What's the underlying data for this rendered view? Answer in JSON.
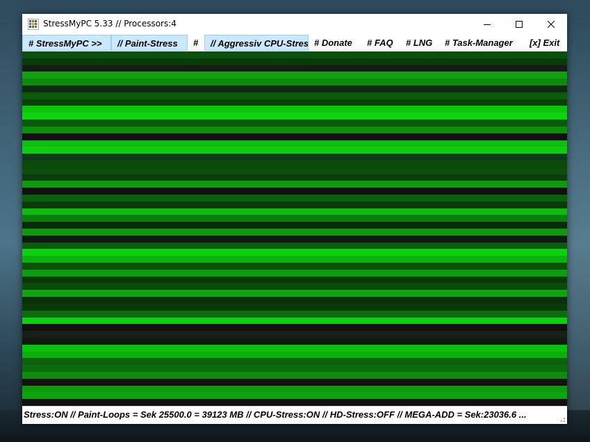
{
  "window": {
    "title": "StressMyPC 5.33 // Processors:4",
    "icon": "app-grid-icon"
  },
  "controls": {
    "minimize": "minimize-icon",
    "maximize": "maximize-icon",
    "close": "close-icon"
  },
  "menu": {
    "items": [
      {
        "label": "# StressMyPC >>",
        "active": true
      },
      {
        "label": "// Paint-Stress",
        "active": true
      },
      {
        "label": "#",
        "active": false
      },
      {
        "label": "// Aggressiv CPU-Stress",
        "active": true
      },
      {
        "label": "# Donate",
        "active": false
      },
      {
        "label": "# FAQ",
        "active": false
      },
      {
        "label": "# LNG",
        "active": false
      },
      {
        "label": "# Task-Manager",
        "active": false
      },
      {
        "label": "[x] Exit",
        "active": false
      }
    ]
  },
  "paint_area": {
    "stripe_colors": [
      "#0d4f0d",
      "#0a3a0a",
      "#151c14",
      "#10a010",
      "#0c8a0c",
      "#0f2a0f",
      "#0b5a0b",
      "#0a3f0a",
      "#0ec20e",
      "#0ed60e",
      "#0a5a0a",
      "#0b8c0b",
      "#130f10",
      "#0fbf0f",
      "#0fcc0f",
      "#0b3b1a",
      "#0a4a0a",
      "#0c4c0c",
      "#0b3a0b",
      "#0d9a0d",
      "#130f10",
      "#0b5f0b",
      "#0a3a0a",
      "#0ebb0e",
      "#0b7f0b",
      "#0a2a0a",
      "#0c9a0c",
      "#101a14",
      "#0c5a0c",
      "#0ed00e",
      "#0cb20c",
      "#0b4f0b",
      "#0d9c0d",
      "#0a3a0a",
      "#0b4a0b",
      "#10a510",
      "#0b2f0b",
      "#0a3a0a",
      "#0d6b0d",
      "#0ed00e",
      "#130f10",
      "#1a1f1a",
      "#0d1a0d",
      "#0ec00e",
      "#0bb00b",
      "#0c5f0c",
      "#0b6b0b",
      "#0c8c0c",
      "#150f12",
      "#0c9a0c",
      "#0ba50b",
      "#140f10"
    ]
  },
  "status": {
    "text": "Stress:ON // Paint-Loops = Sek 25500.0 = 39123 MB // CPU-Stress:ON // HD-Stress:OFF // MEGA-ADD = Sek:23036.6 ..."
  }
}
